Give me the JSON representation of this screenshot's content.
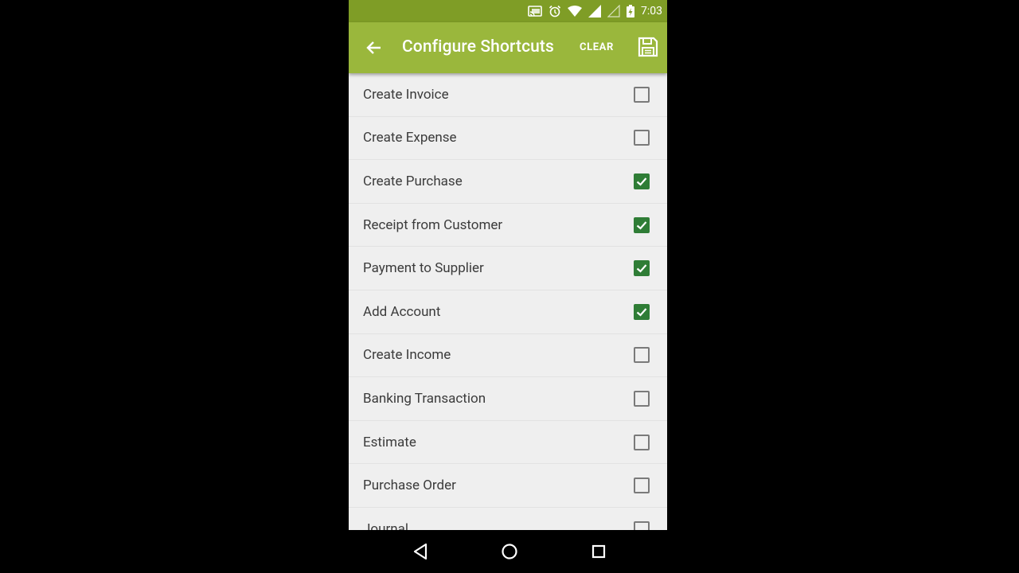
{
  "status_bar": {
    "time": "7:03",
    "icons": [
      "cast-icon",
      "alarm-icon",
      "wifi-icon",
      "signal-icon",
      "signal-empty-icon",
      "battery-charging-icon"
    ]
  },
  "app_bar": {
    "title": "Configure Shortcuts",
    "back_icon": "arrow-back-icon",
    "clear_label": "CLEAR",
    "save_icon": "save-icon",
    "color": "#9ab73c",
    "status_color": "#7f9d26"
  },
  "shortcuts": [
    {
      "label": "Create Invoice",
      "checked": false
    },
    {
      "label": "Create Expense",
      "checked": false
    },
    {
      "label": "Create Purchase",
      "checked": true
    },
    {
      "label": "Receipt from Customer",
      "checked": true
    },
    {
      "label": "Payment to Supplier",
      "checked": true
    },
    {
      "label": "Add Account",
      "checked": true
    },
    {
      "label": "Create Income",
      "checked": false
    },
    {
      "label": "Banking Transaction",
      "checked": false
    },
    {
      "label": "Estimate",
      "checked": false
    },
    {
      "label": "Purchase Order",
      "checked": false
    },
    {
      "label": "Journal",
      "checked": false
    }
  ],
  "checkbox_color": "#2f7d36",
  "nav_bar": {
    "icons": [
      "nav-back-icon",
      "nav-home-icon",
      "nav-recents-icon"
    ]
  }
}
